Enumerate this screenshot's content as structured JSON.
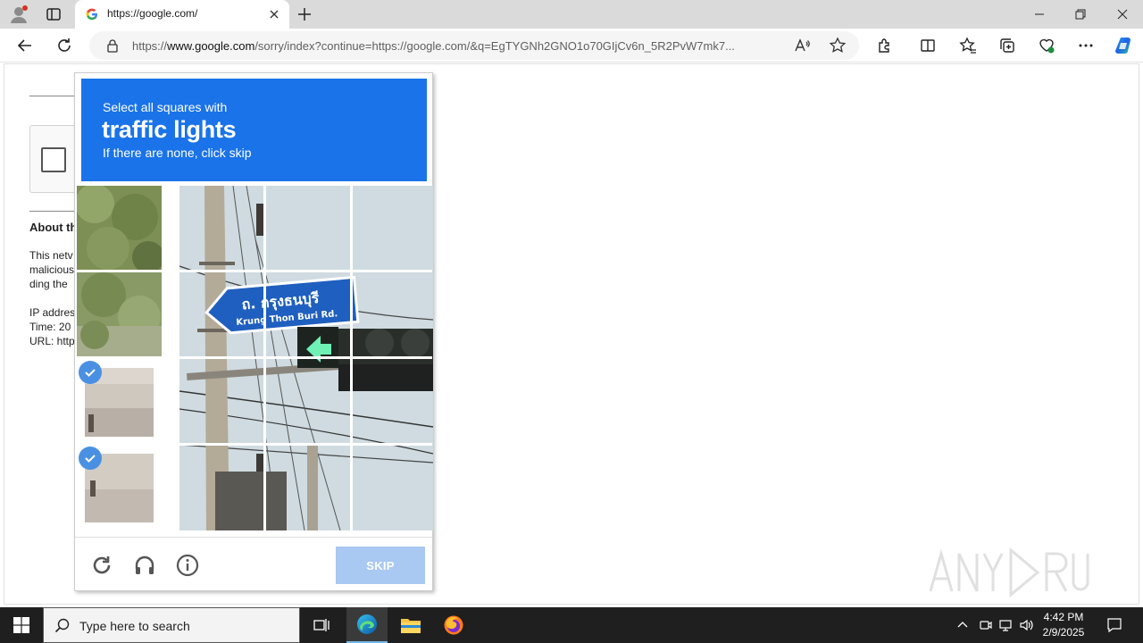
{
  "browser": {
    "tab_title": "https://google.com/",
    "url_prefix": "https://",
    "url_domain": "www.google.com",
    "url_rest": "/sorry/index?continue=https://google.com/&q=EgTYGNh2GNO1o70GIjCv6n_5R2PvW7mk7..."
  },
  "page": {
    "about_heading": "About th",
    "text_lines": [
      "This netv",
      "malicious",
      "ding the"
    ],
    "info_lines": [
      "IP addres",
      "Time: 20",
      "URL: http"
    ]
  },
  "challenge": {
    "instruction": "Select all squares with",
    "target": "traffic lights",
    "hint": "If there are none, click skip",
    "skip_label": "SKIP",
    "selected_tiles": [
      2,
      3
    ]
  },
  "taskbar": {
    "search_placeholder": "Type here to search",
    "time": "4:42 PM",
    "date": "2/9/2025"
  },
  "colors": {
    "banner": "#1a73e8",
    "skip_button": "#a9c8f2",
    "checkmark": "#4a90e2"
  }
}
